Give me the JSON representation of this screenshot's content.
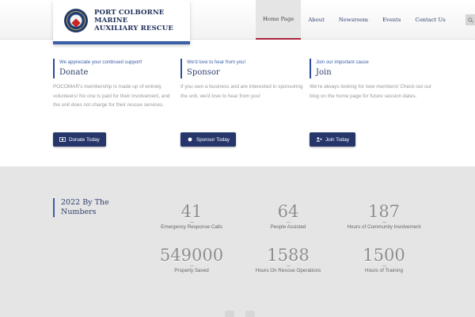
{
  "header": {
    "logo_line1": "PORT COLBORNE MARINE",
    "logo_line2": "AUXILIARY RESCUE",
    "nav": [
      {
        "label": "Home Page",
        "active": true
      },
      {
        "label": "About"
      },
      {
        "label": "Newsroom"
      },
      {
        "label": "Events"
      },
      {
        "label": "Contact Us"
      }
    ],
    "search_icon": "search-icon"
  },
  "features": [
    {
      "kicker": "We appreciate your continued support!",
      "title": "Donate",
      "body": "POCOMAR's membership is made up of entirely volunteers!  No one is paid for their involvement, and the unit does not charge for their rescue services.",
      "button": "Donate Today",
      "icon": "money-icon"
    },
    {
      "kicker": "We'd love to hear from you!",
      "title": "Sponsor",
      "body": "If you own a business and are interested in sponsoring the unit, we'd love to hear from you!",
      "button": "Sponsor Today",
      "icon": "circle-icon"
    },
    {
      "kicker": "Join our important cause",
      "title": "Join",
      "body": "We're always looking for new members! Check out our blog on the home page for future session dates.",
      "button": "Join Today",
      "icon": "add-user-icon"
    }
  ],
  "stats": {
    "heading_line1": "2022 By The",
    "heading_line2": "Numbers",
    "items": [
      {
        "value": "41",
        "label": "Emergency Response Calls"
      },
      {
        "value": "64",
        "label": "People Assisted"
      },
      {
        "value": "187",
        "label": "Hours of Community Involvement"
      },
      {
        "value": "549000",
        "label": "Property Saved"
      },
      {
        "value": "1588",
        "label": "Hours On Rescue Operations"
      },
      {
        "value": "1500",
        "label": "Hours of Training"
      }
    ]
  },
  "colors": {
    "brand_navy": "#26366b",
    "accent_blue": "#3a5ea8",
    "active_nav_underline": "#a9243a",
    "stats_background": "#e5e5e5"
  }
}
